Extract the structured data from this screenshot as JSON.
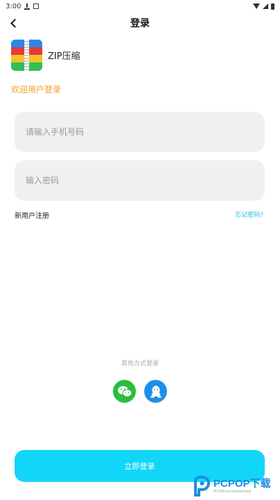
{
  "status_bar": {
    "time": "3:00",
    "icons": [
      "download-icon",
      "notification-icon",
      "wifi-icon",
      "signal-icon",
      "battery-icon"
    ]
  },
  "header": {
    "title": "登录",
    "back_icon": "chevron-left-icon"
  },
  "app": {
    "name": "ZIP压缩",
    "logo_colors": [
      "#2f86e8",
      "#e23b3b",
      "#f5c326",
      "#2fbf5a"
    ]
  },
  "form": {
    "welcome": "欢迎用户登录",
    "phone_placeholder": "请输入手机号码",
    "phone_value": "",
    "password_placeholder": "输入密码",
    "password_value": "",
    "register_label": "新用户注册",
    "forgot_label": "忘记密码?"
  },
  "social": {
    "label": "其他方式登录",
    "options": [
      {
        "name": "WeChat",
        "icon": "wechat-icon",
        "color": "#2bbd3c"
      },
      {
        "name": "QQ",
        "icon": "qq-icon",
        "color": "#1e8fe6"
      }
    ]
  },
  "login_button": {
    "label": "立即登录",
    "color": "#12d6f7"
  },
  "watermark": {
    "main": "PCPOP下载",
    "sub": "PCPOP.com/download"
  },
  "colors": {
    "accent": "#12d6f7",
    "welcome": "#f2a01e",
    "link": "#1fb9ea",
    "input_bg": "#f0f0f0"
  }
}
